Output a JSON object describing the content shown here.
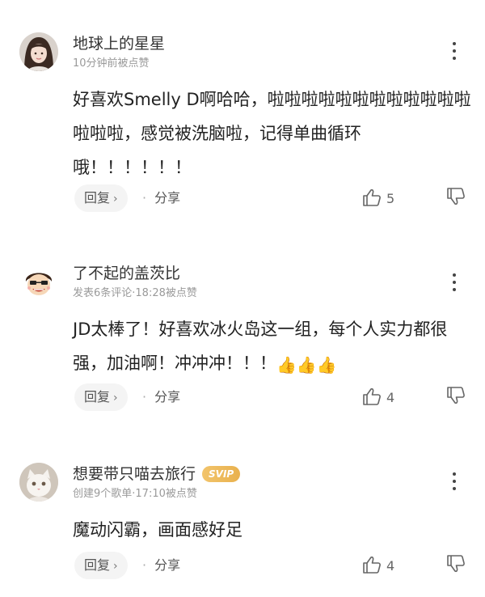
{
  "comments": [
    {
      "username": "地球上的星星",
      "meta": "10分钟前被点赞",
      "content": "好喜欢Smelly D啊哈哈，啦啦啦啦啦啦啦啦啦啦啦啦啦啦啦，感觉被洗脑啦，记得单曲循环哦！！！！！！",
      "reply_label": "回复",
      "share_label": "分享",
      "like_count": "5",
      "avatar_icon": "girl-portrait-avatar"
    },
    {
      "username": "了不起的盖茨比",
      "meta": "发表6条评论·18:28被点赞",
      "content": "JD太棒了！好喜欢冰火岛这一组，每个人实力都很强，加油啊！冲冲冲！！！",
      "emoji": "👍👍👍",
      "reply_label": "回复",
      "share_label": "分享",
      "like_count": "4",
      "avatar_icon": "cartoon-character-avatar"
    },
    {
      "username": "想要带只喵去旅行",
      "badge": "SVIP",
      "meta": "创建9个歌单·17:10被点赞",
      "content": "魔动闪霸，画面感好足",
      "reply_label": "回复",
      "share_label": "分享",
      "like_count": "4",
      "avatar_icon": "white-cat-avatar"
    }
  ],
  "colors": {
    "text_primary": "#222222",
    "text_meta": "#9a9a9a",
    "svip_gold": "#e9b14e",
    "reply_bg": "#f4f4f4"
  }
}
